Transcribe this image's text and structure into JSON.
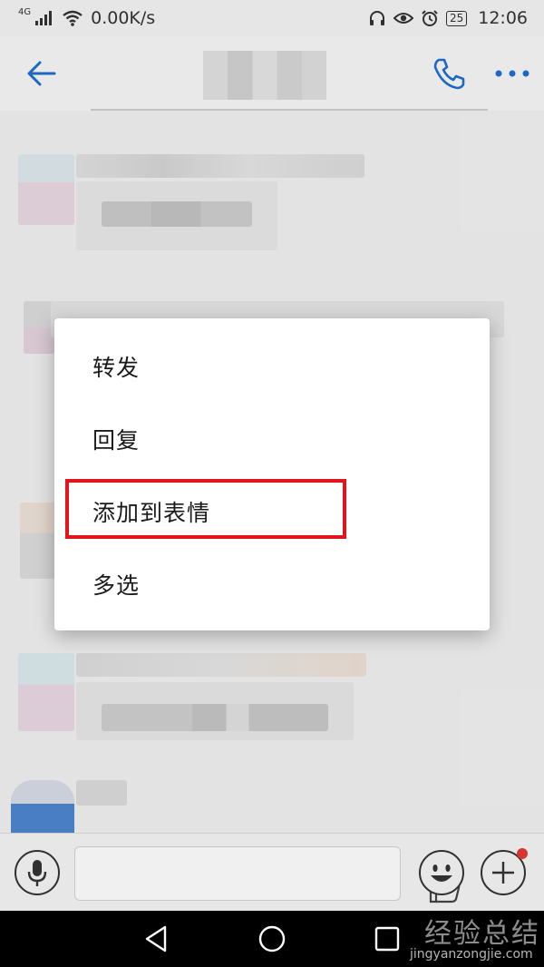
{
  "status_bar": {
    "network_type": "4G",
    "speed": "0.00K/s",
    "battery": "25",
    "time": "12:06"
  },
  "title_bar": {
    "back_icon": "arrow-left-icon",
    "call_icon": "phone-icon",
    "more_icon": "more-dots-icon",
    "accent_color": "#1e6fd0"
  },
  "context_menu": {
    "items": [
      {
        "label": "转发"
      },
      {
        "label": "回复"
      },
      {
        "label": "添加到表情"
      },
      {
        "label": "多选"
      }
    ],
    "highlight_color": "#e3151c"
  },
  "input_bar": {
    "mic_icon": "microphone-icon",
    "like_icon": "thumbs-up-icon",
    "emoji_icon": "smiley-icon",
    "plus_icon": "plus-icon",
    "badge_color": "#e53935"
  },
  "nav_bar": {
    "back_icon": "triangle-back-icon",
    "home_icon": "circle-home-icon",
    "recent_icon": "square-recent-icon"
  },
  "watermark": {
    "main": "经验总结",
    "sub": "jingyanzongjie.com"
  }
}
